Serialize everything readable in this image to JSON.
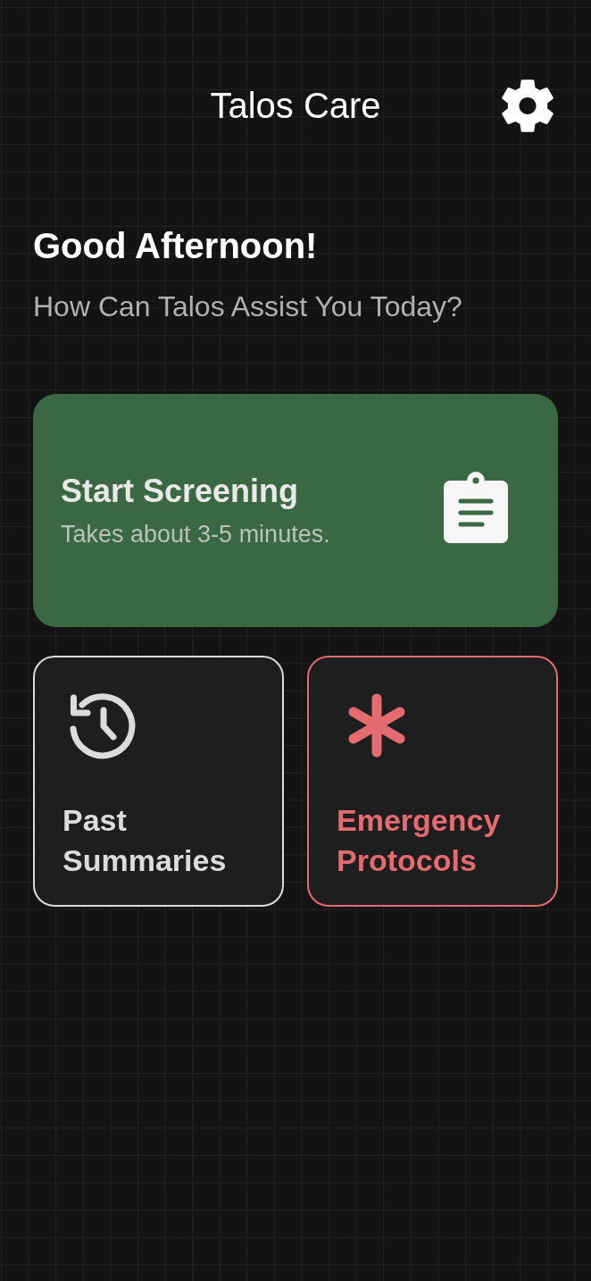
{
  "header": {
    "title": "Talos Care"
  },
  "greeting": {
    "title": "Good Afternoon!",
    "prompt": "How Can Talos Assist You Today?"
  },
  "primary_action": {
    "title": "Start Screening",
    "subtitle": "Takes about 3-5 minutes."
  },
  "tiles": [
    {
      "kind": "history",
      "label": "Past Summaries",
      "color": "#dcdcdc"
    },
    {
      "kind": "emergency",
      "label": "Emergency Protocols",
      "color": "#e46b70"
    }
  ]
}
